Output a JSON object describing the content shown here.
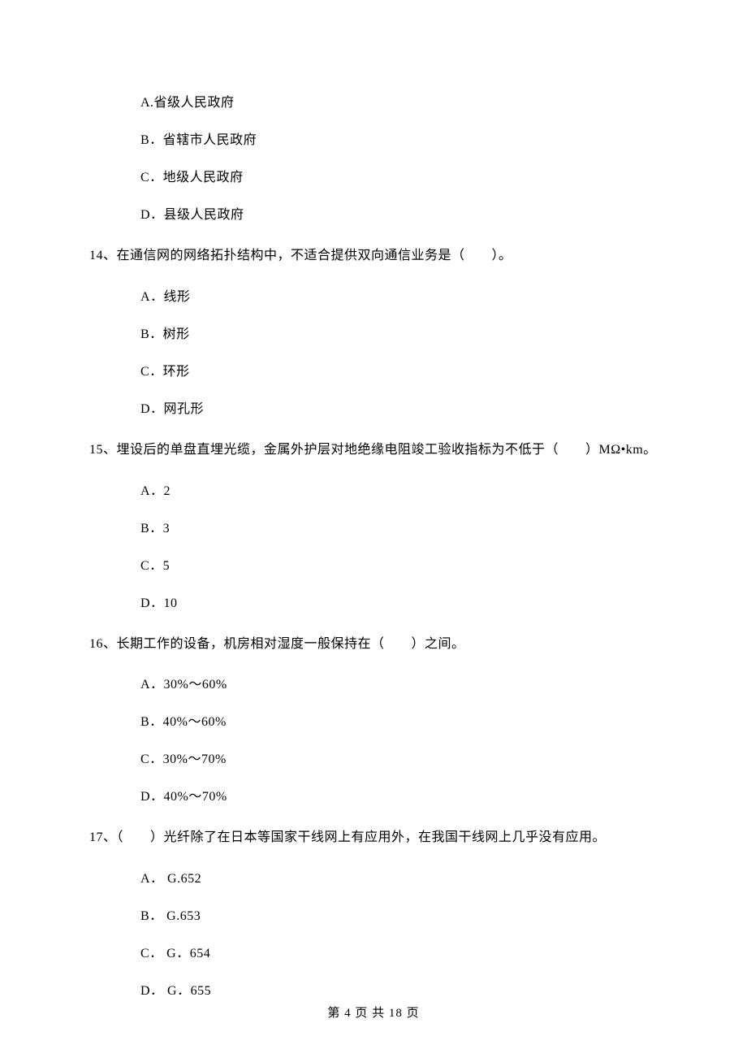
{
  "q13": {
    "options": {
      "a": "A.省级人民政府",
      "b": "B．省辖市人民政府",
      "c": "C．地级人民政府",
      "d": "D．县级人民政府"
    }
  },
  "q14": {
    "text": "14、在通信网的网络拓扑结构中，不适合提供双向通信业务是（　　）。",
    "options": {
      "a": "A．线形",
      "b": "B．树形",
      "c": "C．环形",
      "d": "D．网孔形"
    }
  },
  "q15": {
    "text": "15、埋设后的单盘直埋光缆，金属外护层对地绝缘电阻竣工验收指标为不低于（　　）MΩ•km。",
    "options": {
      "a": "A．2",
      "b": "B．3",
      "c": "C．5",
      "d": "D．10"
    }
  },
  "q16": {
    "text": "16、长期工作的设备，机房相对湿度一般保持在（　　）之间。",
    "options": {
      "a": "A．30%～60%",
      "b": "B．40%～60%",
      "c": "C．30%～70%",
      "d": "D．40%～70%"
    }
  },
  "q17": {
    "text": "17、（　　）光纤除了在日本等国家干线网上有应用外，在我国干线网上几乎没有应用。",
    "options": {
      "a": "A．  G.652",
      "b": "B．  G.653",
      "c": "C．  G．654",
      "d": "D．  G．655"
    }
  },
  "footer": "第 4 页 共 18 页"
}
